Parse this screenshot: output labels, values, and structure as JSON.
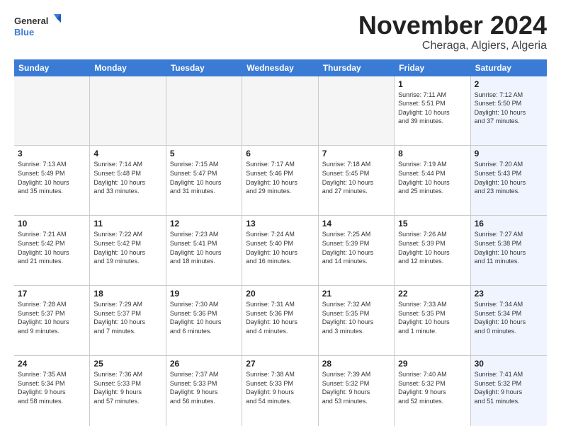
{
  "header": {
    "logo_general": "General",
    "logo_blue": "Blue",
    "month": "November 2024",
    "location": "Cheraga, Algiers, Algeria"
  },
  "days": [
    "Sunday",
    "Monday",
    "Tuesday",
    "Wednesday",
    "Thursday",
    "Friday",
    "Saturday"
  ],
  "weeks": [
    [
      {
        "day": "",
        "empty": true
      },
      {
        "day": "",
        "empty": true
      },
      {
        "day": "",
        "empty": true
      },
      {
        "day": "",
        "empty": true
      },
      {
        "day": "",
        "empty": true
      },
      {
        "day": "1",
        "text": "Sunrise: 7:11 AM\nSunset: 5:51 PM\nDaylight: 10 hours\nand 39 minutes."
      },
      {
        "day": "2",
        "text": "Sunrise: 7:12 AM\nSunset: 5:50 PM\nDaylight: 10 hours\nand 37 minutes.",
        "saturday": true
      }
    ],
    [
      {
        "day": "3",
        "text": "Sunrise: 7:13 AM\nSunset: 5:49 PM\nDaylight: 10 hours\nand 35 minutes."
      },
      {
        "day": "4",
        "text": "Sunrise: 7:14 AM\nSunset: 5:48 PM\nDaylight: 10 hours\nand 33 minutes."
      },
      {
        "day": "5",
        "text": "Sunrise: 7:15 AM\nSunset: 5:47 PM\nDaylight: 10 hours\nand 31 minutes."
      },
      {
        "day": "6",
        "text": "Sunrise: 7:17 AM\nSunset: 5:46 PM\nDaylight: 10 hours\nand 29 minutes."
      },
      {
        "day": "7",
        "text": "Sunrise: 7:18 AM\nSunset: 5:45 PM\nDaylight: 10 hours\nand 27 minutes."
      },
      {
        "day": "8",
        "text": "Sunrise: 7:19 AM\nSunset: 5:44 PM\nDaylight: 10 hours\nand 25 minutes."
      },
      {
        "day": "9",
        "text": "Sunrise: 7:20 AM\nSunset: 5:43 PM\nDaylight: 10 hours\nand 23 minutes.",
        "saturday": true
      }
    ],
    [
      {
        "day": "10",
        "text": "Sunrise: 7:21 AM\nSunset: 5:42 PM\nDaylight: 10 hours\nand 21 minutes."
      },
      {
        "day": "11",
        "text": "Sunrise: 7:22 AM\nSunset: 5:42 PM\nDaylight: 10 hours\nand 19 minutes."
      },
      {
        "day": "12",
        "text": "Sunrise: 7:23 AM\nSunset: 5:41 PM\nDaylight: 10 hours\nand 18 minutes."
      },
      {
        "day": "13",
        "text": "Sunrise: 7:24 AM\nSunset: 5:40 PM\nDaylight: 10 hours\nand 16 minutes."
      },
      {
        "day": "14",
        "text": "Sunrise: 7:25 AM\nSunset: 5:39 PM\nDaylight: 10 hours\nand 14 minutes."
      },
      {
        "day": "15",
        "text": "Sunrise: 7:26 AM\nSunset: 5:39 PM\nDaylight: 10 hours\nand 12 minutes."
      },
      {
        "day": "16",
        "text": "Sunrise: 7:27 AM\nSunset: 5:38 PM\nDaylight: 10 hours\nand 11 minutes.",
        "saturday": true
      }
    ],
    [
      {
        "day": "17",
        "text": "Sunrise: 7:28 AM\nSunset: 5:37 PM\nDaylight: 10 hours\nand 9 minutes."
      },
      {
        "day": "18",
        "text": "Sunrise: 7:29 AM\nSunset: 5:37 PM\nDaylight: 10 hours\nand 7 minutes."
      },
      {
        "day": "19",
        "text": "Sunrise: 7:30 AM\nSunset: 5:36 PM\nDaylight: 10 hours\nand 6 minutes."
      },
      {
        "day": "20",
        "text": "Sunrise: 7:31 AM\nSunset: 5:36 PM\nDaylight: 10 hours\nand 4 minutes."
      },
      {
        "day": "21",
        "text": "Sunrise: 7:32 AM\nSunset: 5:35 PM\nDaylight: 10 hours\nand 3 minutes."
      },
      {
        "day": "22",
        "text": "Sunrise: 7:33 AM\nSunset: 5:35 PM\nDaylight: 10 hours\nand 1 minute."
      },
      {
        "day": "23",
        "text": "Sunrise: 7:34 AM\nSunset: 5:34 PM\nDaylight: 10 hours\nand 0 minutes.",
        "saturday": true
      }
    ],
    [
      {
        "day": "24",
        "text": "Sunrise: 7:35 AM\nSunset: 5:34 PM\nDaylight: 9 hours\nand 58 minutes."
      },
      {
        "day": "25",
        "text": "Sunrise: 7:36 AM\nSunset: 5:33 PM\nDaylight: 9 hours\nand 57 minutes."
      },
      {
        "day": "26",
        "text": "Sunrise: 7:37 AM\nSunset: 5:33 PM\nDaylight: 9 hours\nand 56 minutes."
      },
      {
        "day": "27",
        "text": "Sunrise: 7:38 AM\nSunset: 5:33 PM\nDaylight: 9 hours\nand 54 minutes."
      },
      {
        "day": "28",
        "text": "Sunrise: 7:39 AM\nSunset: 5:32 PM\nDaylight: 9 hours\nand 53 minutes."
      },
      {
        "day": "29",
        "text": "Sunrise: 7:40 AM\nSunset: 5:32 PM\nDaylight: 9 hours\nand 52 minutes."
      },
      {
        "day": "30",
        "text": "Sunrise: 7:41 AM\nSunset: 5:32 PM\nDaylight: 9 hours\nand 51 minutes.",
        "saturday": true
      }
    ]
  ]
}
